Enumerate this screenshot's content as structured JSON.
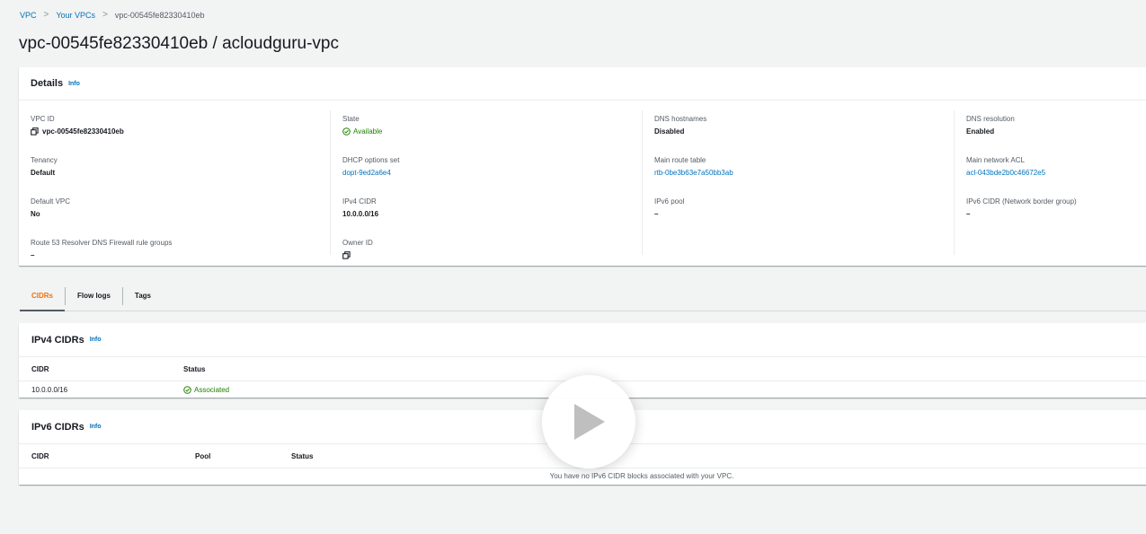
{
  "breadcrumb": {
    "items": [
      "VPC",
      "Your VPCs",
      "vpc-00545fe82330410eb"
    ],
    "separator": ">"
  },
  "page": {
    "title": "vpc-00545fe82330410eb / acloudguru-vpc"
  },
  "details": {
    "title": "Details",
    "info": "Info",
    "columns": [
      [
        {
          "label": "VPC ID",
          "value": "vpc-00545fe82330410eb"
        },
        {
          "label": "Tenancy",
          "value": "Default"
        },
        {
          "label": "Default VPC",
          "value": "No"
        },
        {
          "label": "Route 53 Resolver DNS Firewall rule groups",
          "value": "–"
        }
      ],
      [
        {
          "label": "State",
          "value": "Available"
        },
        {
          "label": "DHCP options set",
          "value": "dopt-9ed2a6e4"
        },
        {
          "label": "IPv4 CIDR",
          "value": "10.0.0.0/16"
        },
        {
          "label": "Owner ID",
          "value": ""
        }
      ],
      [
        {
          "label": "DNS hostnames",
          "value": "Disabled"
        },
        {
          "label": "Main route table",
          "value": "rtb-0be3b63e7a50bb3ab"
        },
        {
          "label": "IPv6 pool",
          "value": "–"
        }
      ],
      [
        {
          "label": "DNS resolution",
          "value": "Enabled"
        },
        {
          "label": "Main network ACL",
          "value": "acl-043bde2b0c46672e5"
        },
        {
          "label": "IPv6 CIDR (Network border group)",
          "value": "–"
        }
      ]
    ]
  },
  "tabs": [
    "CIDRs",
    "Flow logs",
    "Tags"
  ],
  "ipv4_cidrs": {
    "title": "IPv4 CIDRs",
    "info": "Info",
    "columns": [
      "CIDR",
      "Status"
    ],
    "rows": [
      [
        "10.0.0.0/16",
        "Associated"
      ]
    ]
  },
  "ipv6_cidrs": {
    "title": "IPv6 CIDRs",
    "info": "Info",
    "columns": [
      "CIDR",
      "Pool",
      "Status"
    ],
    "empty_message": "You have no IPv6 CIDR blocks associated with your VPC."
  },
  "colors": {
    "link": "#0073bb",
    "success": "#1d8102",
    "active_tab": "#ec7211",
    "background": "#f2f3f3"
  },
  "icons": {
    "copy": "copy-icon",
    "status_ok": "check-circle-icon",
    "play": "play-icon"
  }
}
